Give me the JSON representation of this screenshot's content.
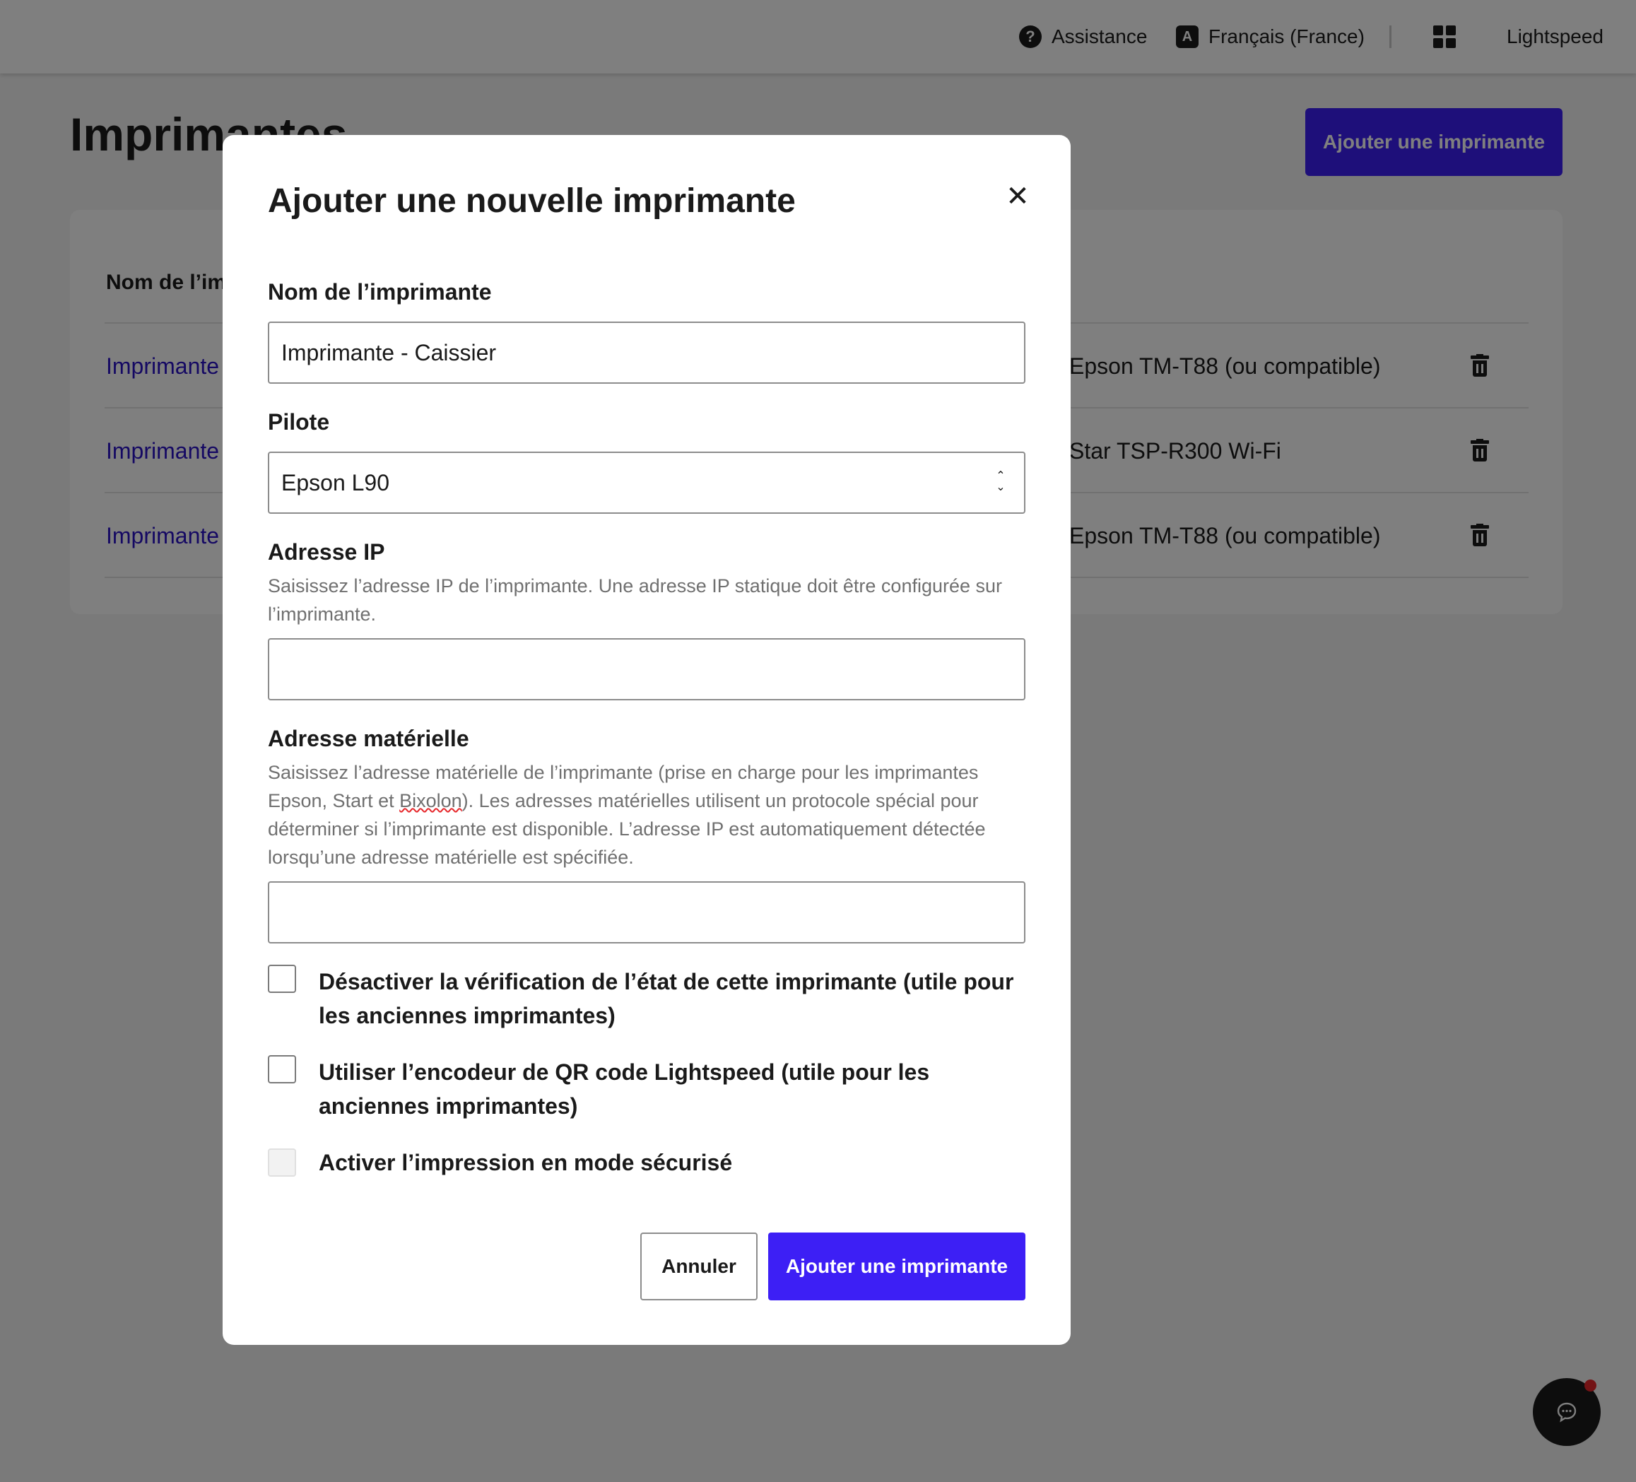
{
  "topbar": {
    "help_label": "Assistance",
    "help_icon_glyph": "?",
    "language_label": "Français (France)",
    "language_icon_glyph": "A",
    "brand_label": "Lightspeed"
  },
  "page": {
    "title": "Imprimantes",
    "add_button_label": "Ajouter une imprimante",
    "table": {
      "column_name": "Nom de l’imprimante",
      "rows": [
        {
          "name": "Imprimante",
          "driver": "Epson TM-T88 (ou compatible)"
        },
        {
          "name": "Imprimante",
          "driver": "Star TSP-R300 Wi-Fi"
        },
        {
          "name": "Imprimante",
          "driver": "Epson TM-T88 (ou compatible)"
        }
      ]
    }
  },
  "modal": {
    "title": "Ajouter une nouvelle imprimante",
    "close_glyph": "✕",
    "name_field": {
      "label": "Nom de l’imprimante",
      "value": "Imprimante - Caissier"
    },
    "driver_field": {
      "label": "Pilote",
      "value": "Epson L90"
    },
    "ip_field": {
      "label": "Adresse IP",
      "help": "Saisissez l’adresse IP de l’imprimante. Une adresse IP statique doit être configurée sur l’imprimante.",
      "value": ""
    },
    "mac_field": {
      "label": "Adresse matérielle",
      "help_before": "Saisissez l’adresse matérielle de l’imprimante (prise en charge pour les imprimantes Epson, Start et ",
      "help_misspelled": "Bixolon",
      "help_after": "). Les adresses matérielles utilisent un protocole spécial pour déterminer si l’imprimante est disponible. L’adresse IP est automatiquement détectée lorsqu’une adresse matérielle est spécifiée.",
      "value": ""
    },
    "checkboxes": [
      {
        "label": "Désactiver la vérification de l’état de cette imprimante (utile pour les anciennes imprimantes)",
        "checked": false,
        "disabled": false
      },
      {
        "label": "Utiliser l’encodeur de QR code Lightspeed (utile pour les anciennes imprimantes)",
        "checked": false,
        "disabled": false
      },
      {
        "label": "Activer l’impression en mode sécurisé",
        "checked": false,
        "disabled": true
      }
    ],
    "cancel_label": "Annuler",
    "submit_label": "Ajouter une imprimante"
  },
  "colors": {
    "accent": "#3d1ff5",
    "link": "#2b12c7",
    "notification_dot": "#e6262a"
  }
}
